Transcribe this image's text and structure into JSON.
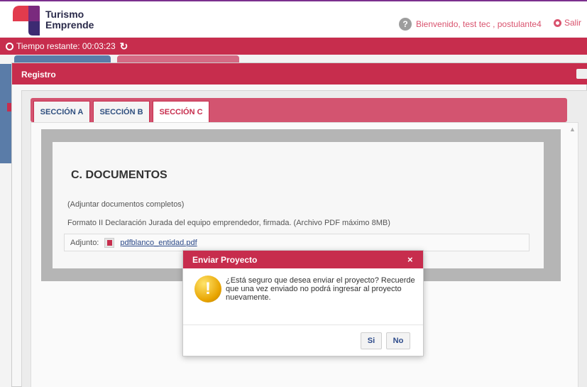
{
  "header": {
    "logo_line1": "Turismo",
    "logo_line2": "Emprende",
    "welcome_text": "Bienvenido, test tec , postulante4",
    "logout_label": "Salir"
  },
  "timer": {
    "label": "Tiempo restante: 00:03:23"
  },
  "dialog": {
    "title": "Registro",
    "tabs": [
      {
        "label": "SECCIÓN A",
        "active": false
      },
      {
        "label": "SECCIÓN B",
        "active": false
      },
      {
        "label": "SECCIÓN C",
        "active": true
      }
    ],
    "section_title": "C. DOCUMENTOS",
    "note": "(Adjuntar documentos completos)",
    "description": "Formato II Declaración Jurada del equipo emprendedor, firmada. (Archivo PDF máximo 8MB)",
    "attachment_label": "Adjunto:",
    "attachment_file": "pdfblanco_entidad.pdf"
  },
  "modal": {
    "title": "Enviar Proyecto",
    "message": "¿Está seguro que desea enviar el proyecto? Recuerde que una vez enviado no podrá ingresar al proyecto nuevamente.",
    "yes_label": "Si",
    "no_label": "No",
    "close_symbol": "×"
  },
  "colors": {
    "brand": "#c72d4d",
    "link": "#2c4a8a"
  }
}
